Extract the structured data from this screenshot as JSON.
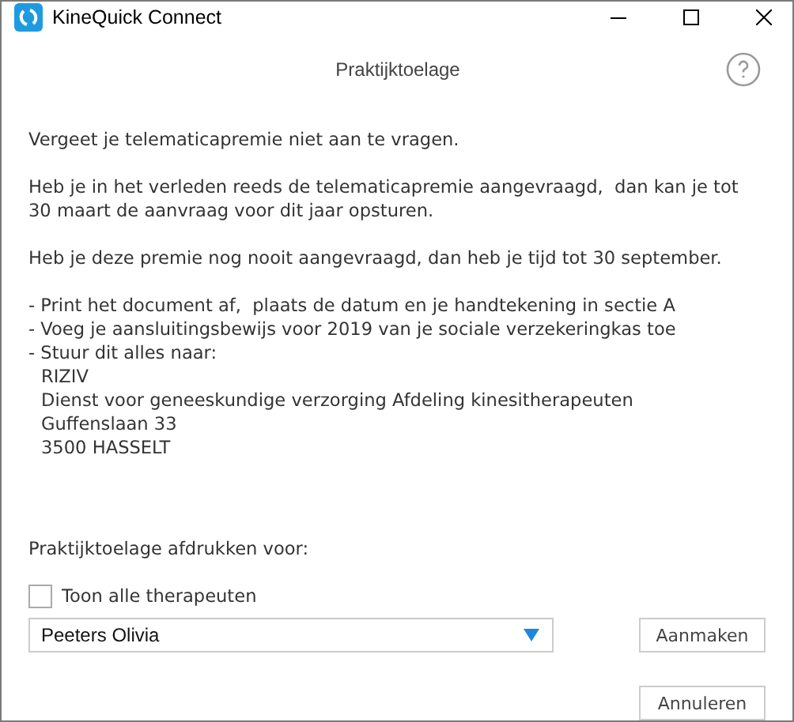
{
  "window": {
    "title": "KineQuick Connect"
  },
  "dialog": {
    "title": "Praktijktoelage",
    "paragraphs": [
      "Vergeet je telematicapremie niet aan te vragen.",
      "Heb je in het verleden reeds de telematicapremie aangevraagd,  dan kan je tot 30 maart de aanvraag voor dit jaar opsturen.",
      "Heb je deze premie nog nooit aangevraagd, dan heb je tijd tot 30 september."
    ],
    "steps": [
      "- Print het document af,  plaats de datum en je handtekening in sectie A",
      "- Voeg je aansluitingsbewijs voor 2019 van je sociale verzekeringkas toe",
      "- Stuur dit alles naar:"
    ],
    "address": [
      "RIZIV",
      "Dienst voor geneeskundige verzorging Afdeling kinesitherapeuten",
      "Guffenslaan 33",
      "3500 HASSELT"
    ],
    "print_for_label": "Praktijktoelage afdrukken voor:",
    "show_all": {
      "label": "Toon alle therapeuten",
      "checked": false
    },
    "therapist": {
      "value": "Peeters Olivia"
    },
    "buttons": [
      "Aanmaken",
      "Annuleren"
    ]
  }
}
